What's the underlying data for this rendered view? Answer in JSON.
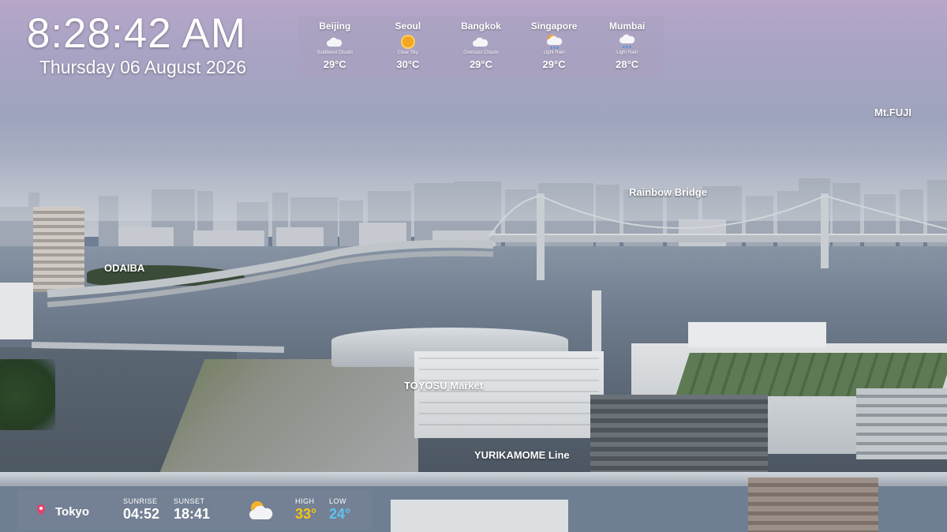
{
  "clock": {
    "time": "8:28:42 AM",
    "date": "Thursday 06 August 2026"
  },
  "weather": {
    "cities": [
      {
        "name": "Beijing",
        "condition": "Scattered Clouds",
        "temp": "29°C",
        "icon": "cloud-icon"
      },
      {
        "name": "Seoul",
        "condition": "Clear Sky",
        "temp": "30°C",
        "icon": "sun-icon"
      },
      {
        "name": "Bangkok",
        "condition": "Overcast Clouds",
        "temp": "29°C",
        "icon": "cloud-icon"
      },
      {
        "name": "Singapore",
        "condition": "Light Rain",
        "temp": "29°C",
        "icon": "sun-rain-icon"
      },
      {
        "name": "Mumbai",
        "condition": "Light Rain",
        "temp": "28°C",
        "icon": "rain-cloud-icon"
      }
    ]
  },
  "labels": {
    "mt_fuji": "Mt.FUJI",
    "rainbow_bridge": "Rainbow Bridge",
    "odaiba": "ODAIBA",
    "toyosu_market": "TOYOSU Market",
    "yurikamome": "YURIKAMOME Line"
  },
  "local": {
    "location": "Tokyo",
    "sunrise_label": "SUNRISE",
    "sunrise": "04:52",
    "sunset_label": "SUNSET",
    "sunset": "18:41",
    "high_label": "HIGH",
    "high": "33°",
    "low_label": "LOW",
    "low": "24°",
    "icon": "partly-cloudy-icon"
  },
  "colors": {
    "high": "#f5c518",
    "low": "#5fc3f0",
    "pin": "#e8406a"
  }
}
